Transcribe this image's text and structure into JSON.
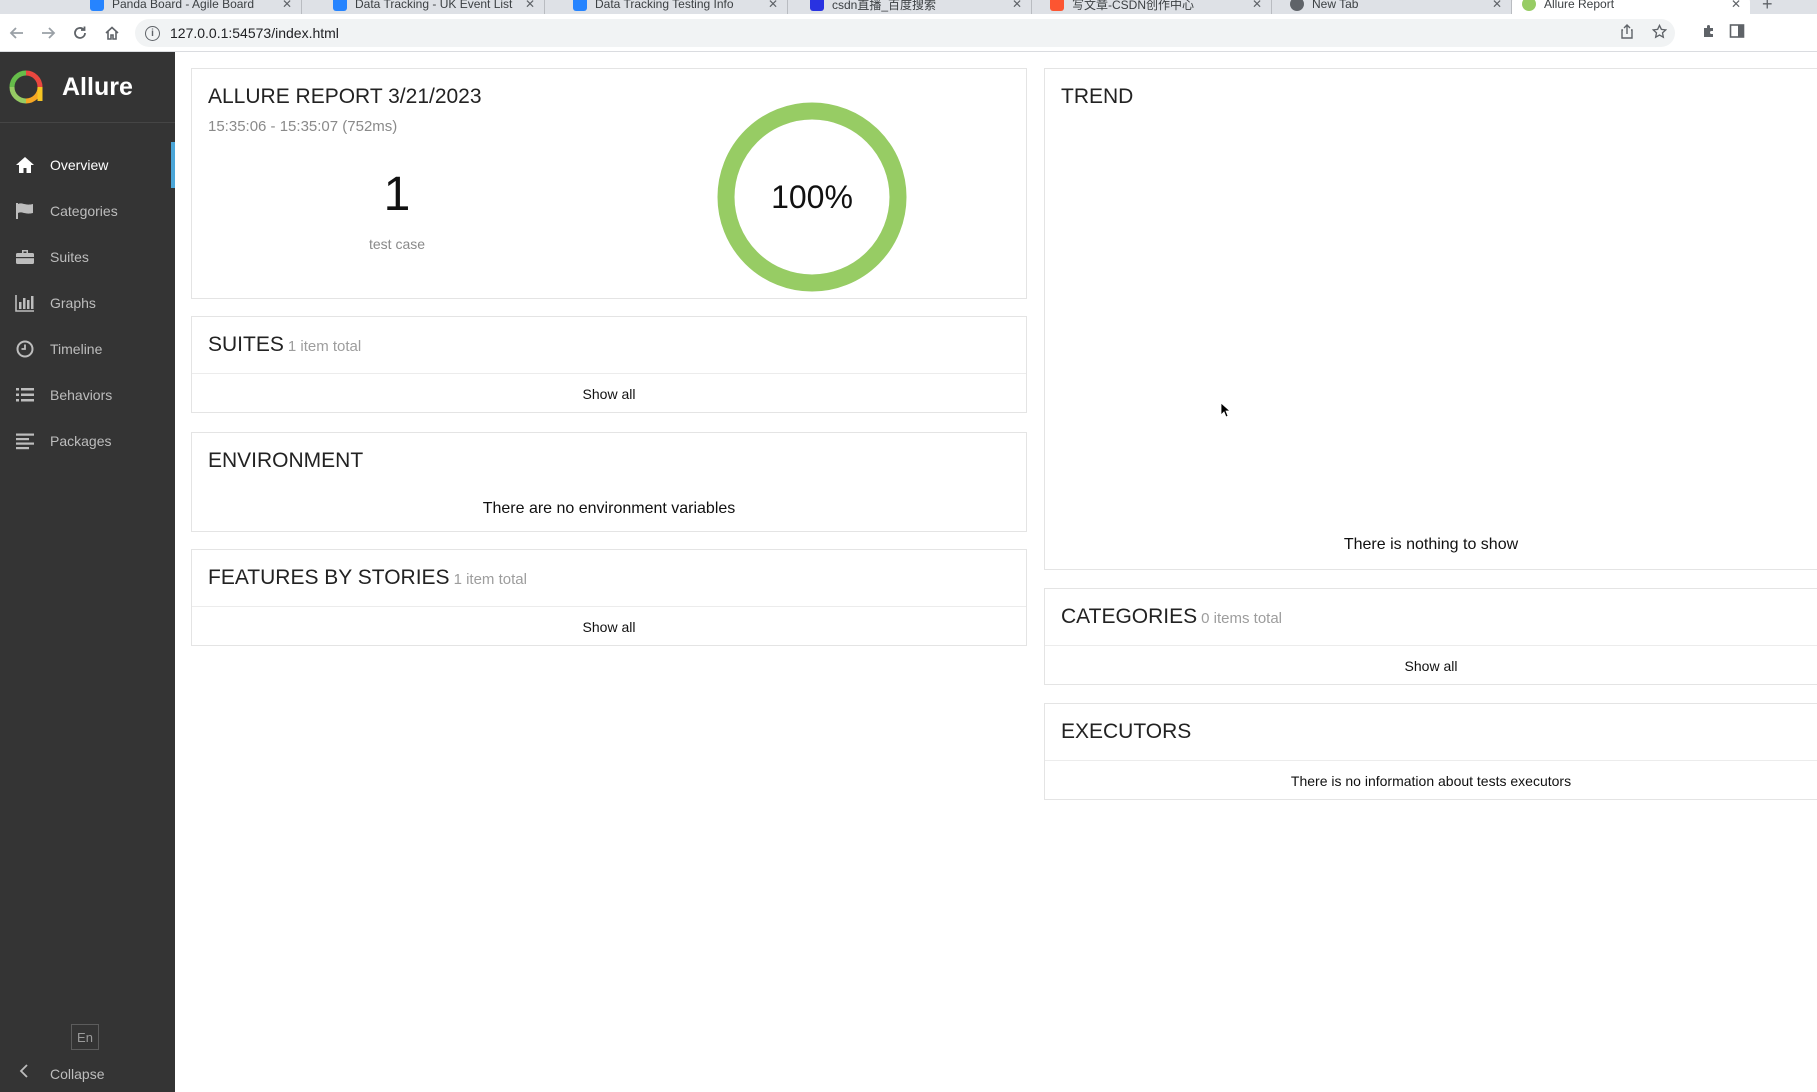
{
  "browser": {
    "tabs": [
      {
        "label": "Panda Board - Agile Board",
        "favicon_color": "#2684ff",
        "active": false
      },
      {
        "label": "Data Tracking - UK Event List",
        "favicon_color": "#2684ff",
        "active": false
      },
      {
        "label": "Data Tracking Testing Info",
        "favicon_color": "#2684ff",
        "active": false
      },
      {
        "label": "csdn直播_百度搜索",
        "favicon_color": "#2932e1",
        "active": false
      },
      {
        "label": "写文章-CSDN创作中心",
        "favicon_color": "#fc5531",
        "active": false
      },
      {
        "label": "New Tab",
        "favicon_color": "#5f6368",
        "active": false
      },
      {
        "label": "Allure Report",
        "favicon_color": "#97cc64",
        "active": true
      }
    ],
    "tab_close_glyph": "✕",
    "new_tab_glyph": "+",
    "url": "127.0.0.1:54573/index.html",
    "info_glyph": "i"
  },
  "sidebar": {
    "brand": "Allure",
    "items": [
      {
        "label": "Overview",
        "icon": "home-icon",
        "active": true
      },
      {
        "label": "Categories",
        "icon": "flag-icon",
        "active": false
      },
      {
        "label": "Suites",
        "icon": "briefcase-icon",
        "active": false
      },
      {
        "label": "Graphs",
        "icon": "bar-chart-icon",
        "active": false
      },
      {
        "label": "Timeline",
        "icon": "clock-icon",
        "active": false
      },
      {
        "label": "Behaviors",
        "icon": "list-icon",
        "active": false
      },
      {
        "label": "Packages",
        "icon": "align-left-icon",
        "active": false
      }
    ],
    "language": "En",
    "collapse_label": "Collapse"
  },
  "summary": {
    "title": "ALLURE REPORT 3/21/2023",
    "time_range": "15:35:06 - 15:35:07 (752ms)",
    "test_count": "1",
    "test_count_label": "test case",
    "pass_percent": 100,
    "pass_percent_label": "100%",
    "pass_color": "#97cc64"
  },
  "suites": {
    "title": "SUITES",
    "subtitle": "1 item total",
    "show_all": "Show all"
  },
  "environment": {
    "title": "ENVIRONMENT",
    "message": "There are no environment variables"
  },
  "features": {
    "title": "FEATURES BY STORIES",
    "subtitle": "1 item total",
    "show_all": "Show all"
  },
  "trend": {
    "title": "TREND",
    "message": "There is nothing to show"
  },
  "categories": {
    "title": "CATEGORIES",
    "subtitle": "0 items total",
    "show_all": "Show all"
  },
  "executors": {
    "title": "EXECUTORS",
    "message": "There is no information about tests executors"
  },
  "colors": {
    "sidebar_bg": "#343434",
    "active_indicator": "#4ba6d8",
    "passed": "#97cc64"
  }
}
